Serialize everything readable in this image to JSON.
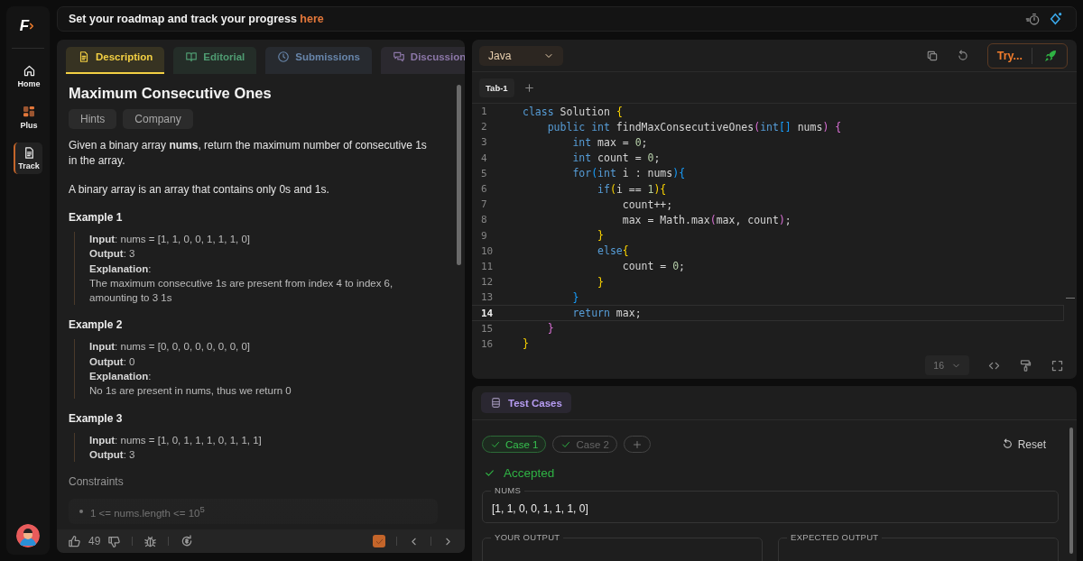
{
  "sidebar": {
    "logo": "F",
    "items": [
      {
        "label": "Home",
        "kind": "home",
        "selected": false
      },
      {
        "label": "Plus",
        "kind": "grid",
        "selected": false
      },
      {
        "label": "Track",
        "kind": "doc",
        "selected": true
      }
    ]
  },
  "banner": {
    "text": "Set your roadmap and track your progress",
    "link": "here"
  },
  "problem": {
    "tabs": [
      {
        "label": "Description",
        "kind": "doc",
        "color": "#f2cf43",
        "selected": true
      },
      {
        "label": "Editorial",
        "kind": "book",
        "color": "#4f9c72",
        "selected": false
      },
      {
        "label": "Submissions",
        "kind": "clock",
        "color": "#6886ab",
        "selected": false
      },
      {
        "label": "Discussion",
        "kind": "chat",
        "color": "#8c77a8",
        "selected": false
      }
    ],
    "title": "Maximum Consecutive Ones",
    "chips": [
      "Hints",
      "Company"
    ],
    "paragraphs": [
      "Given a binary array **nums**, return the maximum number of consecutive 1s in the array.",
      "A binary array is an array that contains only 0s and 1s."
    ],
    "examples": [
      {
        "heading": "Example 1",
        "lines": [
          "**Input**: nums = [1, 1, 0, 0, 1, 1, 1, 0]",
          "**Output**: 3",
          "**Explanation**:",
          "The maximum consecutive 1s are present from index 4 to index 6, amounting to 3 1s"
        ]
      },
      {
        "heading": "Example 2",
        "lines": [
          "**Input**: nums = [0, 0, 0, 0, 0, 0, 0, 0]",
          "**Output**: 0",
          "**Explanation**:",
          "No 1s are present in nums, thus we return 0"
        ]
      },
      {
        "heading": "Example 3",
        "lines": [
          "**Input**: nums = [1, 0, 1, 1, 1, 0, 1, 1, 1]",
          "**Output**:  3"
        ]
      }
    ],
    "constraints_heading": "Constraints",
    "constraints": [
      "1 <= nums.length <= 10$^{5}$"
    ]
  },
  "footer": {
    "likes": "49",
    "solved": true
  },
  "editor": {
    "language": "Java",
    "run_label": "Try...",
    "tabs": [
      {
        "label": "Tab-1",
        "selected": true
      }
    ],
    "font_size": "16",
    "lines": [
      {
        "number": "1",
        "current": false,
        "tokens": [
          {
            "kind": "kw",
            "text": "class"
          },
          {
            "kind": "plain",
            "text": " Solution "
          },
          {
            "kind": "y",
            "text": "{"
          }
        ]
      },
      {
        "number": "2",
        "current": false,
        "tokens": [
          {
            "kind": "kw",
            "text": "    public int"
          },
          {
            "kind": "plain",
            "text": " findMaxConsecutiveOnes"
          },
          {
            "kind": "p",
            "text": "("
          },
          {
            "kind": "kw",
            "text": "int"
          },
          {
            "kind": "b",
            "text": "[]"
          },
          {
            "kind": "plain",
            "text": " nums"
          },
          {
            "kind": "p",
            "text": ")"
          },
          {
            "kind": "p",
            "text": " {"
          }
        ]
      },
      {
        "number": "3",
        "current": false,
        "tokens": [
          {
            "kind": "kw",
            "text": "        int"
          },
          {
            "kind": "plain",
            "text": " max = "
          },
          {
            "kind": "num",
            "text": "0"
          },
          {
            "kind": "plain",
            "text": ";"
          }
        ]
      },
      {
        "number": "4",
        "current": false,
        "tokens": [
          {
            "kind": "kw",
            "text": "        int"
          },
          {
            "kind": "plain",
            "text": " count = "
          },
          {
            "kind": "num",
            "text": "0"
          },
          {
            "kind": "plain",
            "text": ";"
          }
        ]
      },
      {
        "number": "5",
        "current": false,
        "tokens": [
          {
            "kind": "kw",
            "text": "        for"
          },
          {
            "kind": "b",
            "text": "("
          },
          {
            "kind": "kw",
            "text": "int"
          },
          {
            "kind": "plain",
            "text": " i : nums"
          },
          {
            "kind": "b",
            "text": "){"
          }
        ]
      },
      {
        "number": "6",
        "current": false,
        "tokens": [
          {
            "kind": "kw",
            "text": "            if"
          },
          {
            "kind": "y",
            "text": "("
          },
          {
            "kind": "plain",
            "text": "i == "
          },
          {
            "kind": "num",
            "text": "1"
          },
          {
            "kind": "y",
            "text": "){"
          }
        ]
      },
      {
        "number": "7",
        "current": false,
        "tokens": [
          {
            "kind": "plain",
            "text": "                count++;"
          }
        ]
      },
      {
        "number": "8",
        "current": false,
        "tokens": [
          {
            "kind": "plain",
            "text": "                max = Math.max"
          },
          {
            "kind": "p",
            "text": "("
          },
          {
            "kind": "plain",
            "text": "max, count"
          },
          {
            "kind": "p",
            "text": ")"
          },
          {
            "kind": "plain",
            "text": ";"
          }
        ]
      },
      {
        "number": "9",
        "current": false,
        "tokens": [
          {
            "kind": "y",
            "text": "            }"
          }
        ]
      },
      {
        "number": "10",
        "current": false,
        "tokens": [
          {
            "kind": "kw",
            "text": "            else"
          },
          {
            "kind": "y",
            "text": "{"
          }
        ]
      },
      {
        "number": "11",
        "current": false,
        "tokens": [
          {
            "kind": "plain",
            "text": "                count = "
          },
          {
            "kind": "num",
            "text": "0"
          },
          {
            "kind": "plain",
            "text": ";"
          }
        ]
      },
      {
        "number": "12",
        "current": false,
        "tokens": [
          {
            "kind": "y",
            "text": "            }"
          }
        ]
      },
      {
        "number": "13",
        "current": false,
        "tokens": [
          {
            "kind": "b",
            "text": "        }"
          }
        ]
      },
      {
        "number": "14",
        "current": true,
        "tokens": [
          {
            "kind": "kw",
            "text": "        return"
          },
          {
            "kind": "plain",
            "text": " max;"
          }
        ]
      },
      {
        "number": "15",
        "current": false,
        "tokens": [
          {
            "kind": "p",
            "text": "    }"
          }
        ]
      },
      {
        "number": "16",
        "current": false,
        "tokens": [
          {
            "kind": "y",
            "text": "}"
          }
        ]
      }
    ]
  },
  "tests": {
    "tab": "Test Cases",
    "cases": [
      {
        "label": "Case 1",
        "selected": true,
        "passed": true
      },
      {
        "label": "Case 2",
        "selected": false,
        "passed": true
      }
    ],
    "reset": "Reset",
    "status": "Accepted",
    "fields": [
      {
        "label": "NUMS",
        "value": "[1, 1, 0, 0, 1, 1, 1, 0]"
      }
    ],
    "outputs": [
      "YOUR OUTPUT",
      "EXPECTED OUTPUT"
    ]
  }
}
